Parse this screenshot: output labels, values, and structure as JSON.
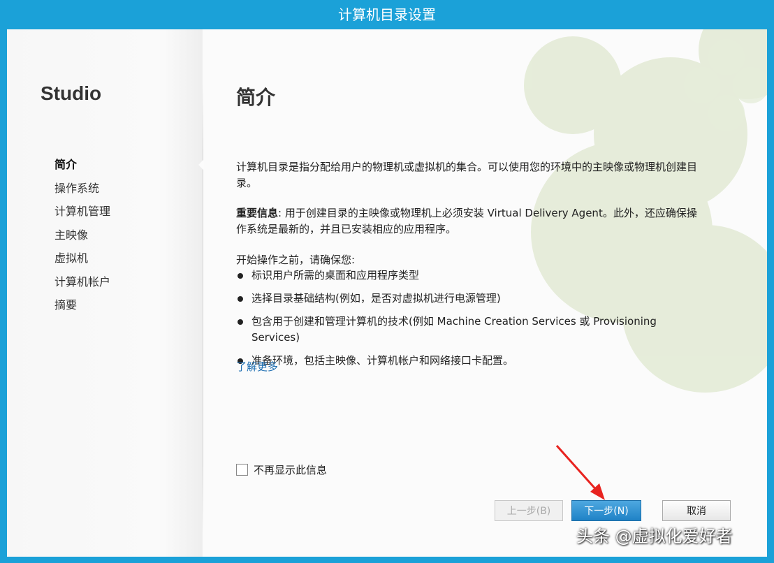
{
  "window": {
    "title": "计算机目录设置"
  },
  "sidebar": {
    "app_name": "Studio",
    "items": [
      {
        "label": "简介",
        "active": true
      },
      {
        "label": "操作系统"
      },
      {
        "label": "计算机管理"
      },
      {
        "label": "主映像"
      },
      {
        "label": "虚拟机"
      },
      {
        "label": "计算机帐户"
      },
      {
        "label": "摘要"
      }
    ]
  },
  "main": {
    "title": "简介",
    "intro": "计算机目录是指分配给用户的物理机或虚拟机的集合。可以使用您的环境中的主映像或物理机创建目录。",
    "important_label": "重要信息",
    "important_text": ": 用于创建目录的主映像或物理机上必须安装 Virtual Delivery Agent。此外，还应确保操作系统是最新的，并且已安装相应的应用程序。",
    "before_start": "开始操作之前，请确保您:",
    "bullets": [
      "标识用户所需的桌面和应用程序类型",
      "选择目录基础结构(例如，是否对虚拟机进行电源管理)",
      "包含用于创建和管理计算机的技术(例如 Machine Creation Services 或 Provisioning Services)",
      "准备环境，包括主映像、计算机帐户和网络接口卡配置。"
    ],
    "learn_more": "了解更多",
    "dont_show_again": "不再显示此信息",
    "dont_show_checked": false
  },
  "buttons": {
    "back": "上一步(B)",
    "next": "下一步(N)",
    "cancel": "取消"
  },
  "watermark": "头条 @虚拟化爱好者",
  "colors": {
    "accent": "#1ba1d8",
    "link": "#1f6fb2",
    "deco": "#dfe8cf",
    "arrow": "#e8231f"
  }
}
